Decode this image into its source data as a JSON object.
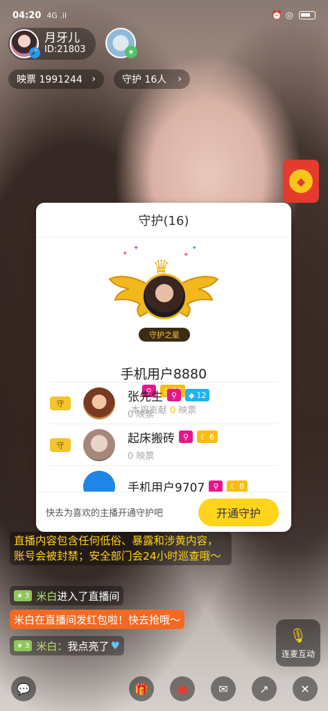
{
  "status": {
    "time": "04:20",
    "network": "4G .il",
    "right": "⏰ ◎"
  },
  "host": {
    "name": "月牙儿",
    "id": "ID:21803"
  },
  "pills": {
    "votes": "映票 1991244",
    "guard": "守护 16人",
    "chevron": "›"
  },
  "panel": {
    "title": "守护(16)",
    "star_label": "守护之星",
    "top_user": {
      "name": "手机用户8880",
      "moon_level": "10",
      "week_label": "本周贡献",
      "week_value": "0",
      "week_unit": "映票"
    },
    "guards": [
      {
        "name": "张先生",
        "badge_type": "diamond",
        "level": "12",
        "sub": "0 映票"
      },
      {
        "name": "起床搬砖",
        "badge_type": "moon",
        "level": "6",
        "sub": "0 映票"
      },
      {
        "name": "手机用户9707",
        "badge_type": "moon",
        "level": "8",
        "sub": ""
      }
    ],
    "shield_text": "守",
    "footer_text": "快去为喜欢的主播开通守护吧",
    "open_button": "开通守护"
  },
  "chat": {
    "notice": "直播内容包含任何低俗、暴露和涉黄内容，账号会被封禁；安全部门会24小时巡查哦～",
    "enter": {
      "level": "3",
      "nick": "米白",
      "text": "进入了直播间"
    },
    "red": "米白在直播间发红包啦！快去抢哦～",
    "like": {
      "level": "3",
      "nick": "米白：",
      "text": "我点亮了"
    }
  },
  "mic_interact_label": "连麦互动",
  "icons": {
    "chat": "chat-bubble-icon",
    "gift": "gift-icon",
    "red_packet": "red-packet-icon",
    "message": "mail-icon",
    "share": "share-icon",
    "close": "close-icon"
  },
  "colors": {
    "accent_yellow": "#ffd41a",
    "key_badge": "#e6178b",
    "moon_badge": "#fbbd12",
    "diamond_badge": "#1fb3f0",
    "red_msg": "#f26a22"
  }
}
